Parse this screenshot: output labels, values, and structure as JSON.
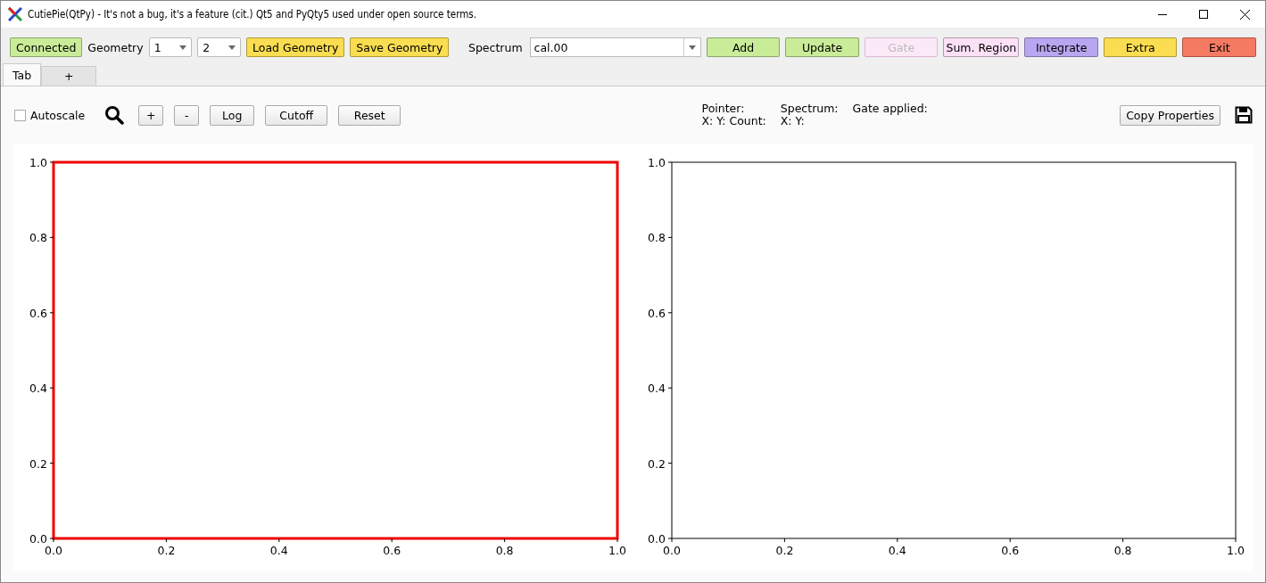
{
  "window": {
    "title": "CutiePie(QtPy) - It's not a bug, it's a feature (cit.) Qt5 and PyQty5 used under open source terms."
  },
  "toolbar": [
    {
      "kind": "button",
      "label": "Connected",
      "color": "#c9ec98",
      "disabled": false
    },
    {
      "kind": "label",
      "label": "Geometry"
    },
    {
      "kind": "dropdown",
      "value": "1"
    },
    {
      "kind": "dropdown",
      "value": "2"
    },
    {
      "kind": "button",
      "label": "Load Geometry",
      "color": "#fadd50",
      "disabled": false
    },
    {
      "kind": "button",
      "label": "Save Geometry",
      "color": "#fadd50",
      "disabled": false
    },
    {
      "kind": "label",
      "label": "Spectrum"
    },
    {
      "kind": "combo",
      "value": "cal.00"
    },
    {
      "kind": "button",
      "label": "Add",
      "color": "#c9ec98",
      "disabled": false
    },
    {
      "kind": "button",
      "label": "Update",
      "color": "#c9ec98",
      "disabled": false
    },
    {
      "kind": "button",
      "label": "Gate",
      "color": "#fbe9f8",
      "disabled": true
    },
    {
      "kind": "button",
      "label": "Sum. Region",
      "color": "#fbe0f6",
      "disabled": false
    },
    {
      "kind": "button",
      "label": "Integrate",
      "color": "#b8a6f0",
      "disabled": false
    },
    {
      "kind": "button",
      "label": "Extra",
      "color": "#fadd50",
      "disabled": false
    },
    {
      "kind": "button",
      "label": "Exit",
      "color": "#f57a62",
      "disabled": false
    }
  ],
  "tabs": [
    {
      "label": "Tab",
      "selected": true
    },
    {
      "label": "+",
      "selected": false
    }
  ],
  "controls": {
    "autoscale": {
      "label": "Autoscale",
      "checked": false
    },
    "buttons": [
      "+",
      "-",
      "Log",
      "Cutoff",
      "Reset"
    ],
    "info": [
      {
        "label": "Pointer:",
        "value": "X: Y: Count:"
      },
      {
        "label": "Spectrum:",
        "value": "X: Y:"
      },
      {
        "label": "Gate applied:"
      }
    ],
    "copy_button": "Copy Properties"
  },
  "plots": [
    {
      "selected": true,
      "chart_data": {
        "type": "line",
        "xlim": [
          0,
          1
        ],
        "ylim": [
          0,
          1
        ],
        "xticks": [
          {
            "value": 0,
            "label": "0.0"
          },
          {
            "value": 0.2,
            "label": "0.2"
          },
          {
            "value": 0.4,
            "label": "0.4"
          },
          {
            "value": 0.6,
            "label": "0.6"
          },
          {
            "value": 0.8,
            "label": "0.8"
          },
          {
            "value": 1,
            "label": "1.0"
          }
        ],
        "yticks": [
          {
            "value": 0,
            "label": "0.0"
          },
          {
            "value": 0.2,
            "label": "0.2"
          },
          {
            "value": 0.4,
            "label": "0.4"
          },
          {
            "value": 0.6,
            "label": "0.6"
          },
          {
            "value": 0.8,
            "label": "0.8"
          },
          {
            "value": 1,
            "label": "1.0"
          }
        ]
      }
    },
    {
      "selected": false,
      "chart_data": {
        "type": "line",
        "xlim": [
          0,
          1
        ],
        "ylim": [
          0,
          1
        ],
        "xticks": [
          {
            "value": 0,
            "label": "0.0"
          },
          {
            "value": 0.2,
            "label": "0.2"
          },
          {
            "value": 0.4,
            "label": "0.4"
          },
          {
            "value": 0.6,
            "label": "0.6"
          },
          {
            "value": 0.8,
            "label": "0.8"
          },
          {
            "value": 1,
            "label": "1.0"
          }
        ],
        "yticks": [
          {
            "value": 0,
            "label": "0.0"
          },
          {
            "value": 0.2,
            "label": "0.2"
          },
          {
            "value": 0.4,
            "label": "0.4"
          },
          {
            "value": 0.6,
            "label": "0.6"
          },
          {
            "value": 0.8,
            "label": "0.8"
          },
          {
            "value": 1,
            "label": "1.0"
          }
        ]
      }
    }
  ]
}
